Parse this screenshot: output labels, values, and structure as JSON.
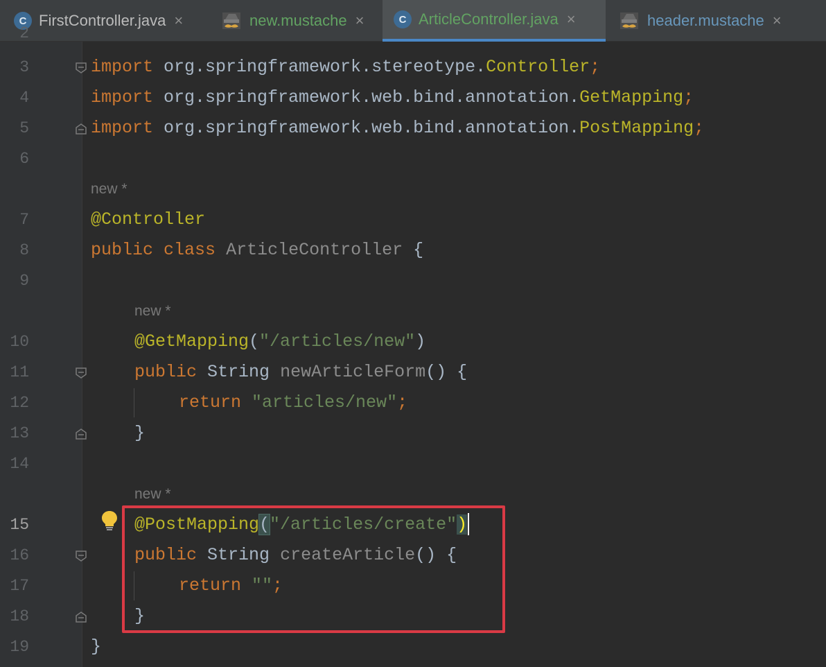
{
  "tabs": [
    {
      "icon": "c-class-icon",
      "label": "FirstController.java",
      "active": false
    },
    {
      "icon": "mustache-icon",
      "label": "new.mustache",
      "active": false
    },
    {
      "icon": "c-class-icon",
      "label": "ArticleController.java",
      "active": true
    },
    {
      "icon": "mustache-icon",
      "label": "header.mustache",
      "active": false
    }
  ],
  "tab_close_glyph": "×",
  "class_icon_letter": "C",
  "line_numbers": {
    "l2": "2",
    "l3": "3",
    "l4": "4",
    "l5": "5",
    "l6": "6",
    "l7": "7",
    "l8": "8",
    "l9": "9",
    "l10": "10",
    "l11": "11",
    "l12": "12",
    "l13": "13",
    "l14": "14",
    "l15": "15",
    "l16": "16",
    "l17": "17",
    "l18": "18",
    "l19": "19"
  },
  "current_line": "15",
  "code": {
    "import_kw": "import",
    "imp1_pkg": " org.springframework.stereotype.",
    "imp1_cls": "Controller",
    "imp2_pkg": " org.springframework.web.bind.annotation.",
    "imp2_cls": "GetMapping",
    "imp3_pkg": " org.springframework.web.bind.annotation.",
    "imp3_cls": "PostMapping",
    "semi": ";",
    "hint_new": "new *",
    "ann_controller": "@Controller",
    "public_kw": "public",
    "class_kw": "class",
    "class_name": "ArticleController",
    "open_brace": " {",
    "close_brace": "}",
    "ann_get": "@GetMapping",
    "get_path": "\"/articles/new\"",
    "string_type": "String",
    "method1": "newArticleForm",
    "parens_brace": "() {",
    "return_kw": "return",
    "ret1": "\"articles/new\"",
    "ann_post": "@PostMapping",
    "post_path": "\"/articles/create\"",
    "method2": "createArticle",
    "ret2": "\"\"",
    "lparen": "(",
    "rparen": ")"
  },
  "colors": {
    "background": "#2b2b2b",
    "keyword": "#cc7832",
    "annotation": "#bbb529",
    "string": "#6a8759",
    "highlight_box": "#d93a45",
    "active_tab_underline": "#4a88c7"
  }
}
